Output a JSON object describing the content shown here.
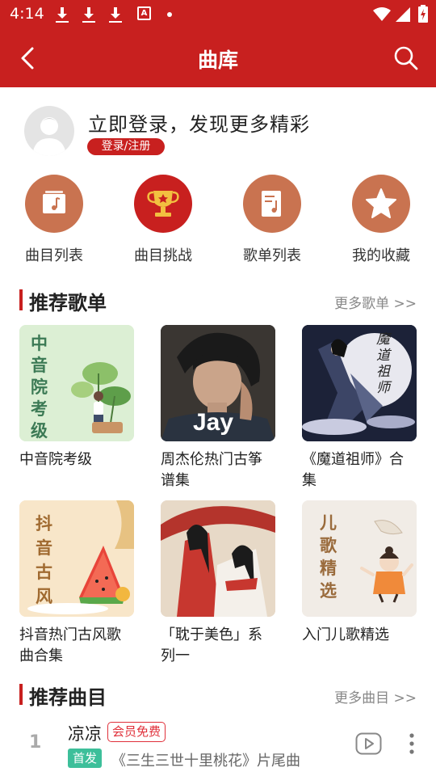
{
  "status_bar": {
    "time": "4:14",
    "notification_icons": [
      "download-icon",
      "download-icon",
      "download-icon",
      "a-icon",
      "dot-icon"
    ],
    "right_icons": [
      "wifi-icon",
      "signal-icon",
      "battery-charging-icon"
    ]
  },
  "header": {
    "title": "曲库",
    "left_icon": "back-arrow-icon",
    "right_icon": "search-icon",
    "background": "#c8201f"
  },
  "login": {
    "prompt": "立即登录，发现更多精彩",
    "button_label": "登录/注册"
  },
  "quick_entries": [
    {
      "label": "曲目列表",
      "icon": "music-folder-icon"
    },
    {
      "label": "曲目挑战",
      "icon": "trophy-icon"
    },
    {
      "label": "歌单列表",
      "icon": "music-note-list-icon"
    },
    {
      "label": "我的收藏",
      "icon": "star-icon"
    }
  ],
  "recommended_playlists": {
    "title": "推荐歌单",
    "more_label": "更多歌单 >>",
    "items": [
      {
        "name": "中音院考级",
        "cover_text": "中音院考级"
      },
      {
        "name": "周杰伦热门古筝谱集",
        "cover_text": "Jay"
      },
      {
        "name": "《魔道祖师》合集",
        "cover_text": "魔道祖师"
      },
      {
        "name": "抖音热门古风歌曲合集",
        "cover_text": "抖音古风"
      },
      {
        "name": "「耽于美色」系列一",
        "cover_text": ""
      },
      {
        "name": "入门儿歌精选",
        "cover_text": "儿歌精选"
      }
    ]
  },
  "recommended_songs": {
    "title": "推荐曲目",
    "more_label": "更多曲目 >>",
    "items": [
      {
        "rank": "1",
        "title": "凉凉",
        "badge": "会员免费",
        "tag": "首发",
        "subtitle": "《三生三世十里桃花》片尾曲"
      }
    ]
  },
  "colors": {
    "brand_red": "#c8201f",
    "entry_brown": "#c97350",
    "tag_green": "#3dbf9a"
  }
}
